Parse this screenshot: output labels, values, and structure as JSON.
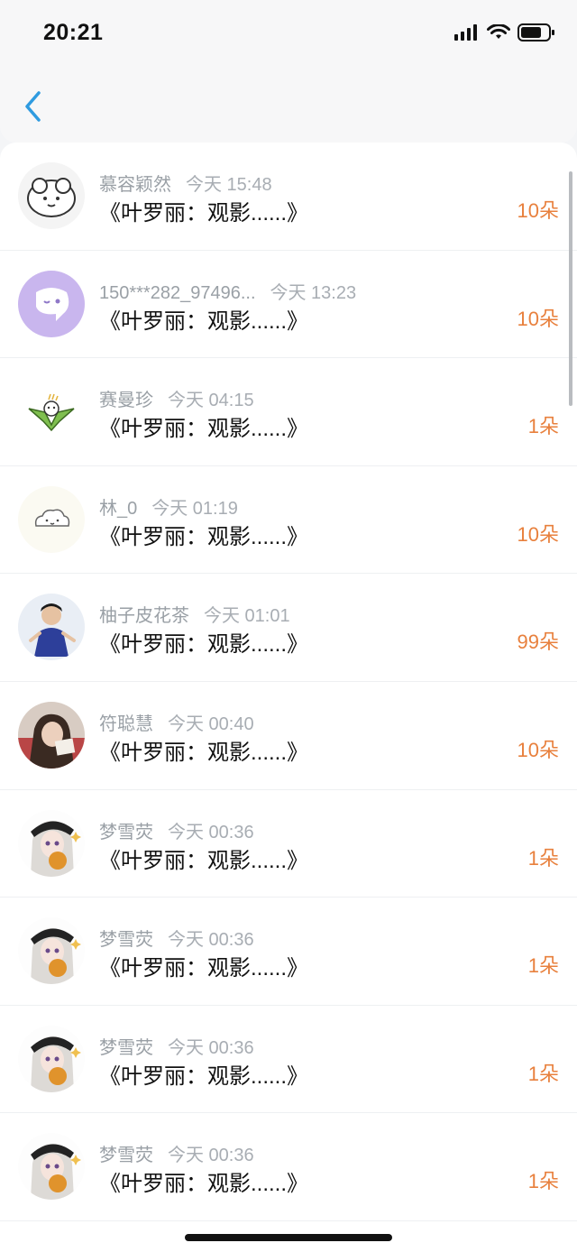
{
  "status": {
    "time": "20:21"
  },
  "nav": {
    "back_icon": "chevron-left-icon"
  },
  "items": [
    {
      "name": "慕容颖然",
      "time": "今天 15:48",
      "title": "《叶罗丽：观影......》",
      "amount": "10朵",
      "avatar": "sheep"
    },
    {
      "name": "150***282_97496...",
      "time": "今天 13:23",
      "title": "《叶罗丽：观影......》",
      "amount": "10朵",
      "avatar": "purple-chat"
    },
    {
      "name": "赛曼珍",
      "time": "今天 04:15",
      "title": "《叶罗丽：观影......》",
      "amount": "1朵",
      "avatar": "bird"
    },
    {
      "name": "林_0",
      "time": "今天 01:19",
      "title": "《叶罗丽：观影......》",
      "amount": "10朵",
      "avatar": "cloud"
    },
    {
      "name": "柚子皮花茶",
      "time": "今天 01:01",
      "title": "《叶罗丽：观影......》",
      "amount": "99朵",
      "avatar": "skater"
    },
    {
      "name": "符聪慧",
      "time": "今天 00:40",
      "title": "《叶罗丽：观影......》",
      "amount": "10朵",
      "avatar": "girl-photo"
    },
    {
      "name": "梦雪荧",
      "time": "今天 00:36",
      "title": "《叶罗丽：观影......》",
      "amount": "1朵",
      "avatar": "anime-girl"
    },
    {
      "name": "梦雪荧",
      "time": "今天 00:36",
      "title": "《叶罗丽：观影......》",
      "amount": "1朵",
      "avatar": "anime-girl"
    },
    {
      "name": "梦雪荧",
      "time": "今天 00:36",
      "title": "《叶罗丽：观影......》",
      "amount": "1朵",
      "avatar": "anime-girl"
    },
    {
      "name": "梦雪荧",
      "time": "今天 00:36",
      "title": "《叶罗丽：观影......》",
      "amount": "1朵",
      "avatar": "anime-girl"
    }
  ],
  "colors": {
    "accent": "#2f9be0",
    "amount": "#e8803d"
  }
}
